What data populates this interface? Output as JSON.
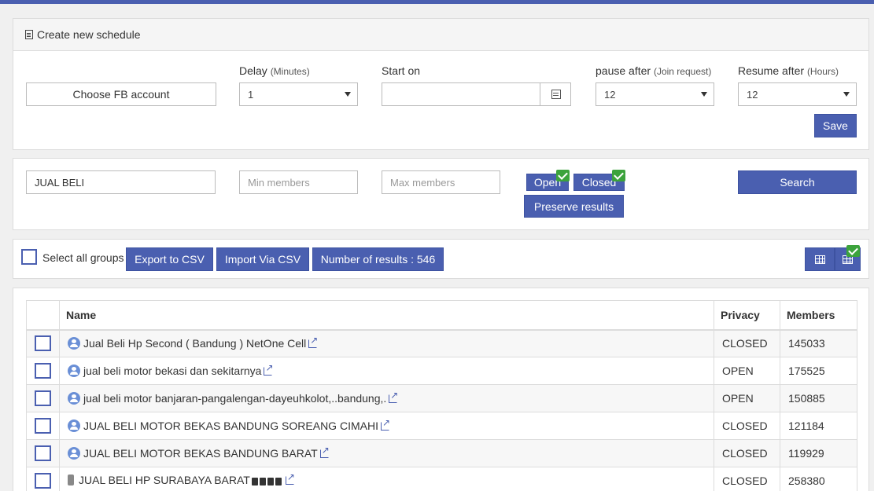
{
  "schedule": {
    "heading": "Create new schedule",
    "fb_account_label": "Choose FB account",
    "delay": {
      "label": "Delay",
      "unit": "(Minutes)",
      "value": "1"
    },
    "start_on": {
      "label": "Start on",
      "value": ""
    },
    "pause_after": {
      "label": "pause after",
      "unit": "(Join request)",
      "value": "12"
    },
    "resume_after": {
      "label": "Resume after",
      "unit": "(Hours)",
      "value": "12"
    },
    "save_label": "Save"
  },
  "search": {
    "keyword": "JUAL BELI",
    "min_members_placeholder": "Min members",
    "max_members_placeholder": "Max members",
    "open_label": "Open",
    "closed_label": "Closed",
    "preserve_label": "Preserve results",
    "search_label": "Search"
  },
  "toolbar": {
    "select_all_label": "Select all groups",
    "export_label": "Export to CSV",
    "import_label": "Import Via CSV",
    "results_label": "Number of results : 546"
  },
  "table": {
    "headers": {
      "name": "Name",
      "privacy": "Privacy",
      "members": "Members"
    },
    "rows": [
      {
        "name": "Jual Beli Hp Second ( Bandung ) NetOne Cell",
        "privacy": "CLOSED",
        "members": "145033",
        "icon": "group-icon"
      },
      {
        "name": "jual beli motor bekasi dan sekitarnya",
        "privacy": "OPEN",
        "members": "175525",
        "icon": "group-icon"
      },
      {
        "name": "jual beli motor banjaran-pangalengan-dayeuhkolot,..bandung,.",
        "privacy": "OPEN",
        "members": "150885",
        "icon": "group-icon"
      },
      {
        "name": "JUAL BELI MOTOR BEKAS BANDUNG SOREANG CIMAHI",
        "privacy": "CLOSED",
        "members": "121184",
        "icon": "group-icon"
      },
      {
        "name": "JUAL BELI MOTOR BEKAS BANDUNG BARAT",
        "privacy": "CLOSED",
        "members": "119929",
        "icon": "group-icon"
      },
      {
        "name": "JUAL BELI HP SURABAYA BARAT",
        "privacy": "CLOSED",
        "members": "258380",
        "icon": "phone-icon"
      }
    ]
  },
  "colors": {
    "accent": "#4a5fb0",
    "check": "#3ca33c"
  }
}
